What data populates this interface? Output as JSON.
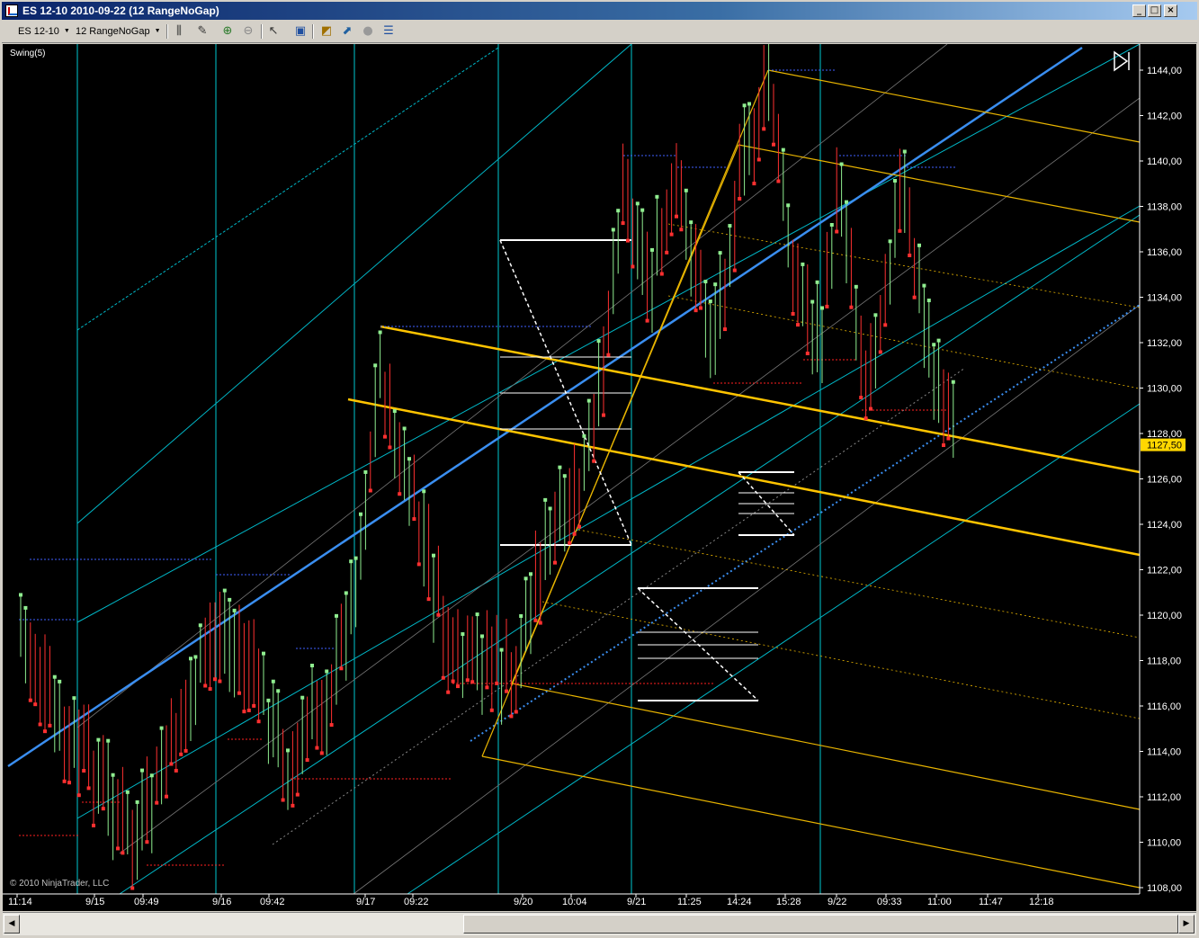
{
  "window": {
    "title": "ES 12-10  2010-09-22 (12 RangeNoGap)",
    "controls": {
      "minimize": "_",
      "restore": "□",
      "close": "×"
    }
  },
  "toolbar": {
    "instrument": "ES 12-10",
    "period": "12 RangeNoGap",
    "icons": [
      "bar-type-icon",
      "drawing-tool-icon",
      "zoom-in-icon",
      "zoom-out-icon",
      "pointer-icon",
      "snapshot-icon",
      "data-box-icon",
      "indicators-icon",
      "strategies-icon",
      "properties-icon"
    ]
  },
  "chart": {
    "indicator_label": "Swing(5)",
    "copyright": "© 2010 NinjaTrader, LLC",
    "last_price": "1127,50",
    "price_axis": {
      "min": 1108,
      "max": 1144,
      "step": 2,
      "labels": [
        "1144,00",
        "1142,00",
        "1140,00",
        "1138,00",
        "1136,00",
        "1134,00",
        "1132,00",
        "1130,00",
        "1128,00",
        "1126,00",
        "1124,00",
        "1122,00",
        "1120,00",
        "1118,00",
        "1116,00",
        "1114,00",
        "1112,00",
        "1110,00",
        "1108,00"
      ]
    },
    "time_axis": {
      "labels": [
        "11:14",
        "9/15",
        "09:49",
        "9/16",
        "09:42",
        "9/17",
        "09:22",
        "9/20",
        "10:04",
        "9/21",
        "11:25",
        "14:24",
        "15:28",
        "9/22",
        "09:33",
        "11:00",
        "11:47",
        "12:18"
      ]
    },
    "colors": {
      "background": "#000000",
      "up_bar": "#90ee90",
      "down_bar": "#ff3030",
      "session_line": "#00c8d0",
      "pitchfork_cyan": "#00b8c8",
      "pitchfork_gold": "#e8b400",
      "regression_blue": "#3a8ef0",
      "swing_high": "#4060ff",
      "swing_low": "#ff2020",
      "fib": "#ffffff",
      "price_marker": "#ffd700"
    }
  },
  "scrollbar": {
    "left": "◀",
    "right": "▶"
  }
}
